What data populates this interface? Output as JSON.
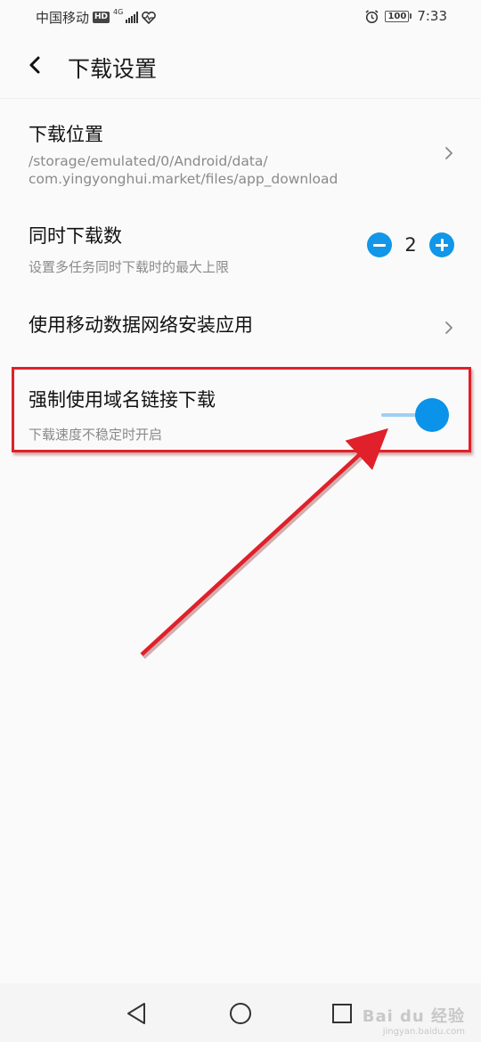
{
  "status_bar": {
    "carrier": "中国移动",
    "hd_badge": "HD",
    "network": "4G",
    "battery": "100",
    "time": "7:33",
    "icons": [
      "hd-badge-icon",
      "signal-icon",
      "health-icon",
      "alarm-icon",
      "battery-icon"
    ]
  },
  "header": {
    "back_icon": "chevron-left-icon",
    "title": "下载设置"
  },
  "settings": {
    "download_location": {
      "label": "下载位置",
      "path_line1": "/storage/emulated/0/Android/data/",
      "path_line2": "com.yingyonghui.market/files/app_download"
    },
    "concurrent_downloads": {
      "label": "同时下载数",
      "description": "设置多任务同时下载时的最大上限",
      "value": "2"
    },
    "mobile_data_install": {
      "label": "使用移动数据网络安装应用"
    },
    "force_domain_download": {
      "label": "强制使用域名链接下载",
      "description": "下载速度不稳定时开启",
      "enabled": true
    }
  },
  "annotation": {
    "highlight_color": "#e0202a"
  },
  "nav_bar": {
    "icons": [
      "back-triangle-icon",
      "home-circle-icon",
      "recents-square-icon"
    ]
  },
  "watermark": {
    "brand": "Bai du 经验",
    "site": "jingyan.baidu.com"
  },
  "colors": {
    "accent": "#1296e8",
    "toggle_knob": "#0a93e8",
    "toggle_track": "#9fd0f2",
    "background": "#fafafa",
    "secondary_text": "#8a8a8a"
  }
}
